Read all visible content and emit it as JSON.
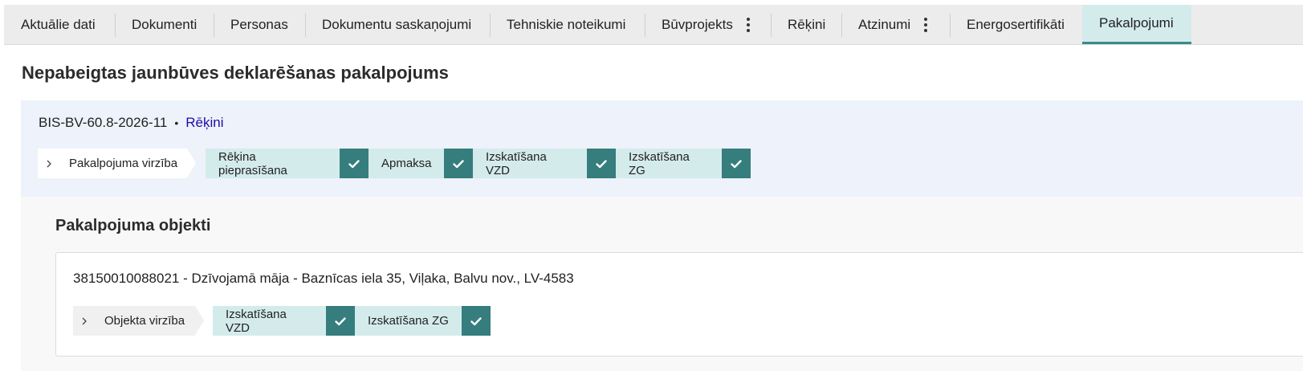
{
  "tabs": [
    {
      "label": "Aktuālie dati",
      "active": false,
      "menu": false
    },
    {
      "label": "Dokumenti",
      "active": false,
      "menu": false
    },
    {
      "label": "Personas",
      "active": false,
      "menu": false
    },
    {
      "label": "Dokumentu saskaņojumi",
      "active": false,
      "menu": false
    },
    {
      "label": "Tehniskie noteikumi",
      "active": false,
      "menu": false
    },
    {
      "label": "Būvprojekts",
      "active": false,
      "menu": true
    },
    {
      "label": "Rēķini",
      "active": false,
      "menu": false
    },
    {
      "label": "Atzinumi",
      "active": false,
      "menu": true
    },
    {
      "label": "Energosertifikāti",
      "active": false,
      "menu": false
    },
    {
      "label": "Pakalpojumi",
      "active": true,
      "menu": false
    }
  ],
  "page_title": "Nepabeigtas jaunbūves deklarēšanas pakalpojums",
  "service": {
    "reference": "BIS-BV-60.8-2026-11",
    "separator": "•",
    "link_label": "Rēķini",
    "flow_label": "Pakalpojuma virzība",
    "steps": [
      {
        "label": "Rēķina pieprasīšana",
        "done": true
      },
      {
        "label": "Apmaksa",
        "done": true
      },
      {
        "label": "Izskatīšana VZD",
        "done": true
      },
      {
        "label": "Izskatīšana ZG",
        "done": true
      }
    ]
  },
  "objects": {
    "title": "Pakalpojuma objekti",
    "items": [
      {
        "description": "38150010088021 - Dzīvojamā māja - Baznīcas iela 35, Viļaka, Balvu nov., LV-4583",
        "flow_label": "Objekta virzība",
        "steps": [
          {
            "label": "Izskatīšana VZD",
            "done": true
          },
          {
            "label": "Izskatīšana ZG",
            "done": true
          }
        ]
      }
    ]
  },
  "colors": {
    "accent": "#367d7e",
    "step_bg": "#d4ebeb",
    "panel_bg": "#eef2fa",
    "link": "#1a0dab"
  },
  "icons": {
    "flow_expand": "chevron-right-icon",
    "step_done": "check-icon",
    "tab_menu": "more-vertical-icon"
  }
}
